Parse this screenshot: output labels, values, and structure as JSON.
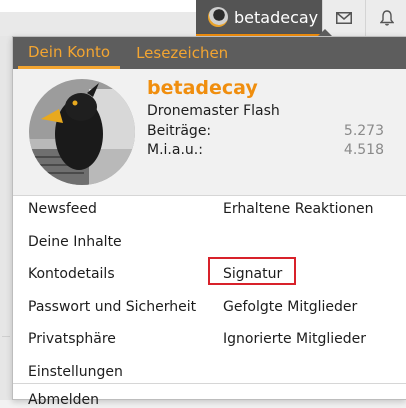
{
  "topnav": {
    "username": "betadecay",
    "icons": [
      "avatar-icon",
      "envelope-icon",
      "bell-icon"
    ]
  },
  "colors": {
    "accent": "#f08e0e",
    "tab_text": "#f3a531",
    "header_bg": "#5d5d5d",
    "highlight_border": "#d8212a"
  },
  "menu": {
    "tabs": [
      {
        "label": "Dein Konto",
        "active": true
      },
      {
        "label": "Lesezeichen",
        "active": false
      }
    ],
    "profile": {
      "name": "betadecay",
      "title": "Dronemaster Flash",
      "stats": [
        {
          "label": "Beiträge:",
          "value": "5.273"
        },
        {
          "label": "M.i.a.u.:",
          "value": "4.518"
        }
      ]
    },
    "left_links": [
      "Newsfeed",
      "Deine Inhalte",
      "Kontodetails",
      "Passwort und Sicherheit",
      "Privatsphäre",
      "Einstellungen"
    ],
    "right_links": [
      "Erhaltene Reaktionen",
      "Signatur",
      "Gefolgte Mitglieder",
      "Ignorierte Mitglieder"
    ],
    "partial_link": "Abmelden"
  }
}
